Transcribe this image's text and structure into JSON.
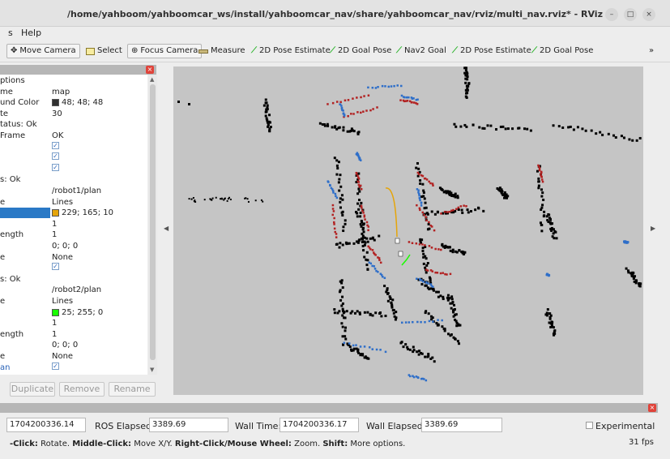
{
  "window": {
    "title": "/home/yahboom/yahboomcar_ws/install/yahboomcar_nav/share/yahboomcar_nav/rviz/multi_nav.rviz* - RViz",
    "minimize": "–",
    "maximize": "□",
    "close": "×"
  },
  "menu": {
    "partial": "s",
    "help": "Help"
  },
  "toolbar": {
    "move_camera": "Move Camera",
    "select": "Select",
    "focus_camera": "Focus Camera",
    "measure": "Measure",
    "pose_estimate_1": "2D Pose Estimate",
    "goal_pose_1": "2D Goal Pose",
    "nav2_goal": "Nav2 Goal",
    "pose_estimate_2": "2D Pose Estimate",
    "goal_pose_2": "2D Goal Pose",
    "overflow": "»"
  },
  "displays": {
    "rows": [
      {
        "key": "ptions",
        "value": ""
      },
      {
        "key": "me",
        "value": "map"
      },
      {
        "key": "und Color",
        "value": "48; 48; 48",
        "swatch": "#303030"
      },
      {
        "key": "te",
        "value": "30"
      },
      {
        "key": "tatus: Ok",
        "value": ""
      },
      {
        "key": "Frame",
        "value": "OK"
      },
      {
        "key": "",
        "value": "",
        "check": true
      },
      {
        "key": "",
        "value": "",
        "check": true
      },
      {
        "key": "",
        "value": "",
        "check": true
      },
      {
        "key": "s: Ok",
        "value": ""
      },
      {
        "key": "",
        "value": "/robot1/plan"
      },
      {
        "key": "e",
        "value": "Lines"
      },
      {
        "key": "",
        "value": "229; 165; 10",
        "swatch": "#e5a50a",
        "selected": true
      },
      {
        "key": "",
        "value": "1"
      },
      {
        "key": "ength",
        "value": "1"
      },
      {
        "key": "",
        "value": "0; 0; 0"
      },
      {
        "key": "e",
        "value": "None"
      },
      {
        "key": "",
        "value": "",
        "check": true
      },
      {
        "key": "s: Ok",
        "value": ""
      },
      {
        "key": "",
        "value": "/robot2/plan"
      },
      {
        "key": "e",
        "value": "Lines"
      },
      {
        "key": "",
        "value": "25; 255; 0",
        "swatch": "#19ff00"
      },
      {
        "key": "",
        "value": "1"
      },
      {
        "key": "ength",
        "value": "1"
      },
      {
        "key": "",
        "value": "0; 0; 0"
      },
      {
        "key": "e",
        "value": "None"
      },
      {
        "key": "an",
        "value": "",
        "check": true,
        "link": true
      }
    ],
    "buttons": {
      "duplicate": "Duplicate",
      "remove": "Remove",
      "rename": "Rename"
    }
  },
  "time": {
    "ros_time_value": "1704200336.14",
    "ros_elapsed_label": "ROS Elapsed:",
    "ros_elapsed_value": "3389.69",
    "wall_time_label": "Wall Time:",
    "wall_time_value": "1704200336.17",
    "wall_elapsed_label": "Wall Elapsed:",
    "wall_elapsed_value": "3389.69",
    "experimental_label": "Experimental"
  },
  "status": {
    "help_prefix": "-Click:",
    "help_rotate": " Rotate. ",
    "help_middle": "Middle-Click:",
    "help_move": " Move X/Y. ",
    "help_right": "Right-Click/Mouse Wheel:",
    "help_zoom": " Zoom. ",
    "help_shift": "Shift:",
    "help_more": " More options.",
    "fps": "31 fps"
  },
  "colors": {
    "map_bg": "#c5c5c5",
    "obstacle": "#000000",
    "robot1_costmap": "#b22222",
    "robot2_costmap": "#2f6fc9",
    "robot1_plan": "#e5a50a",
    "robot2_plan": "#19ff00"
  }
}
